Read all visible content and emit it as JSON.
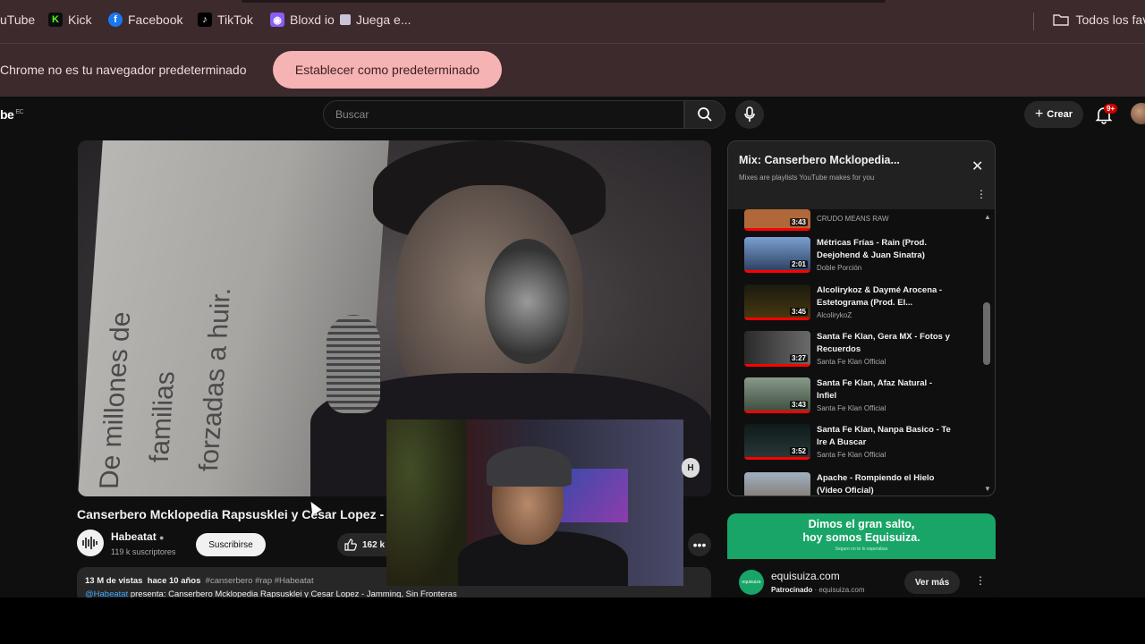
{
  "bookmarks": [
    {
      "label": "uTube",
      "icon": "youtube-icon"
    },
    {
      "label": "Kick",
      "icon": "kick-icon",
      "color": "#53fc18"
    },
    {
      "label": "Facebook",
      "icon": "facebook-icon",
      "color": "#1877f2"
    },
    {
      "label": "TikTok",
      "icon": "tiktok-icon",
      "color": "#000000"
    },
    {
      "label": "Bloxd io",
      "icon": "bloxd-icon",
      "color": "#8b5cf6"
    },
    {
      "label": "Juega e...",
      "icon": "page-icon"
    }
  ],
  "bookmarks_right": {
    "label": "Todos los favo",
    "icon": "folder-icon"
  },
  "infobar": {
    "message": "Chrome no es tu navegador predeterminado",
    "button": "Establecer como predeterminado"
  },
  "header": {
    "logo": "be",
    "logo_sup": "EC",
    "search_placeholder": "Buscar",
    "create_label": "Crear",
    "notif_badge": "9+"
  },
  "video": {
    "paper_lines": [
      "De millones de",
      "familias",
      "forzadas a huir."
    ],
    "title": "Canserbero Mcklopedia Rapsusklei y Cesar Lopez -",
    "channel_name": "Habeatat",
    "subscribers": "119 k suscriptores",
    "subscribe_label": "Suscribirse",
    "likes": "162 k",
    "handle_label": "H"
  },
  "description": {
    "views": "13 M de vistas",
    "date": "hace 10 años",
    "tags": "#canserbero #rap #Habeatat",
    "mention": "@Habeatat",
    "text": " presenta: Canserbero Mcklopedia Rapsusklei y Cesar Lopez - Jamming, Sin Fronteras"
  },
  "playlist": {
    "title": "Mix: Canserbero Mcklopedia...",
    "subtitle": "Mixes are playlists YouTube makes for you",
    "items": [
      {
        "title": "",
        "channel": "CRUDO MEANS RAW",
        "duration": "3:43",
        "thumb_color": "#b0683a"
      },
      {
        "title": "Métricas Frías - Rain (Prod. Deejohend & Juan Sinatra)",
        "channel": "Doble Porción",
        "duration": "2:01",
        "thumb_color": "#3a5a8a"
      },
      {
        "title": "Alcolirykoz & Daymé Arocena - Estetograma (Prod. El...",
        "channel": "AlcolirykoZ",
        "duration": "3:45",
        "thumb_color": "#2a2a1a"
      },
      {
        "title": "Santa Fe Klan, Gera MX - Fotos y Recuerdos",
        "channel": "Santa Fe Klan Official",
        "duration": "3:27",
        "thumb_color": "#4a4a4a"
      },
      {
        "title": "Santa Fe Klan, Afaz Natural - Infiel",
        "channel": "Santa Fe Klan Official",
        "duration": "3:43",
        "thumb_color": "#5a6a5a"
      },
      {
        "title": "Santa Fe Klan, Nanpa Basico - Te Ire A Buscar",
        "channel": "Santa Fe Klan Official",
        "duration": "3:52",
        "thumb_color": "#1e2a2a"
      },
      {
        "title": "Apache - Rompiendo el Hielo (Video Oficial)",
        "channel": "",
        "duration": "",
        "thumb_color": "#8a9ab0"
      }
    ]
  },
  "ad": {
    "headline_1": "Dimos el gran salto,",
    "headline_2": "hoy somos Equisuiza.",
    "small": "Seguro no te lo esperabas",
    "logo_text": "equisuiza",
    "domain": "equisuiza.com",
    "sponsored": "Patrocinado",
    "sponsored_domain": " · equisuiza.com",
    "cta": "Ver más"
  }
}
